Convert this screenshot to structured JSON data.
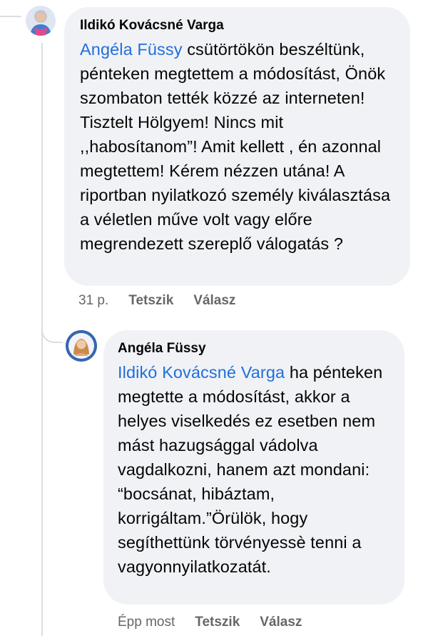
{
  "comments": [
    {
      "author": "Ildikó Kovácsné Varga",
      "mention": "Angéla Füssy",
      "text": " csütörtökön beszéltünk, pénteken megtettem a módosítást, Önök szombaton tették közzé az interneten! Tisztelt Hölgyem! Nincs mit ,,habosítanom”! Amit kellett , én azonnal megtettem! Kérem nézzen utána! A riportban nyilatkozó személy kiválasztása a véletlen műve volt vagy előre megrendezett szereplő válogatás ?",
      "time": "31 p.",
      "like_label": "Tetszik",
      "reply_label": "Válasz"
    },
    {
      "author": "Angéla Füssy",
      "mention": "Ildikó Kovácsné Varga",
      "text": " ha pénteken megtette a módosítást, akkor a helyes viselkedés ez esetben nem mást hazugsággal vádolva vagdalkozni, hanem azt mondani: “bocsánat, hibáztam, korrigáltam.”Örülök, hogy segíthettünk törvényessè tenni a vagyonnyilatkozatát.",
      "time": "Épp most",
      "like_label": "Tetszik",
      "reply_label": "Válasz"
    }
  ],
  "colors": {
    "bubble": "#f0f2f5",
    "mention": "#216fdb",
    "meta": "#65676b",
    "thread_line": "#dadde1"
  }
}
